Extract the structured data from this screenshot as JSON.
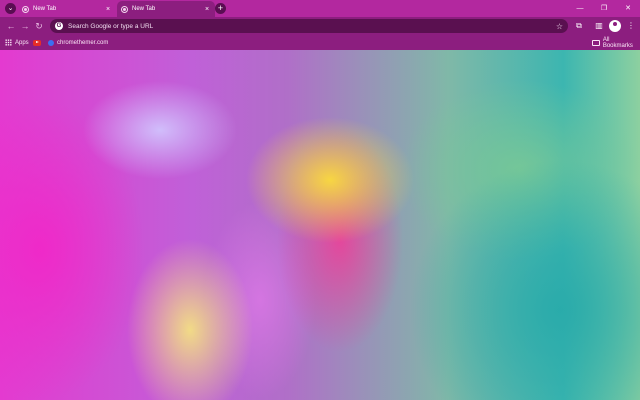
{
  "tabs": [
    {
      "title": "New Tab",
      "active": false
    },
    {
      "title": "New Tab",
      "active": true
    }
  ],
  "tabstrip": {
    "tab_search_icon": "chevron-down-icon",
    "new_tab_icon": "plus-icon",
    "close_icon": "×"
  },
  "window_controls": {
    "minimize": "—",
    "restore": "❐",
    "close": "✕"
  },
  "toolbar": {
    "back": "←",
    "forward": "→",
    "reload": "↻",
    "omnibox_placeholder": "Search Google or type a URL",
    "star": "☆"
  },
  "bookmarks": {
    "apps_label": "Apps",
    "items": [
      {
        "label": "",
        "icon": "youtube-icon"
      },
      {
        "label": "chromethemer.com",
        "icon": "chromethemer-icon"
      }
    ],
    "all_bookmarks_label": "All Bookmarks"
  },
  "colors": {
    "frame": "#b3289f",
    "toolbar": "#8c1e7f",
    "omnibox": "#5a1050"
  }
}
